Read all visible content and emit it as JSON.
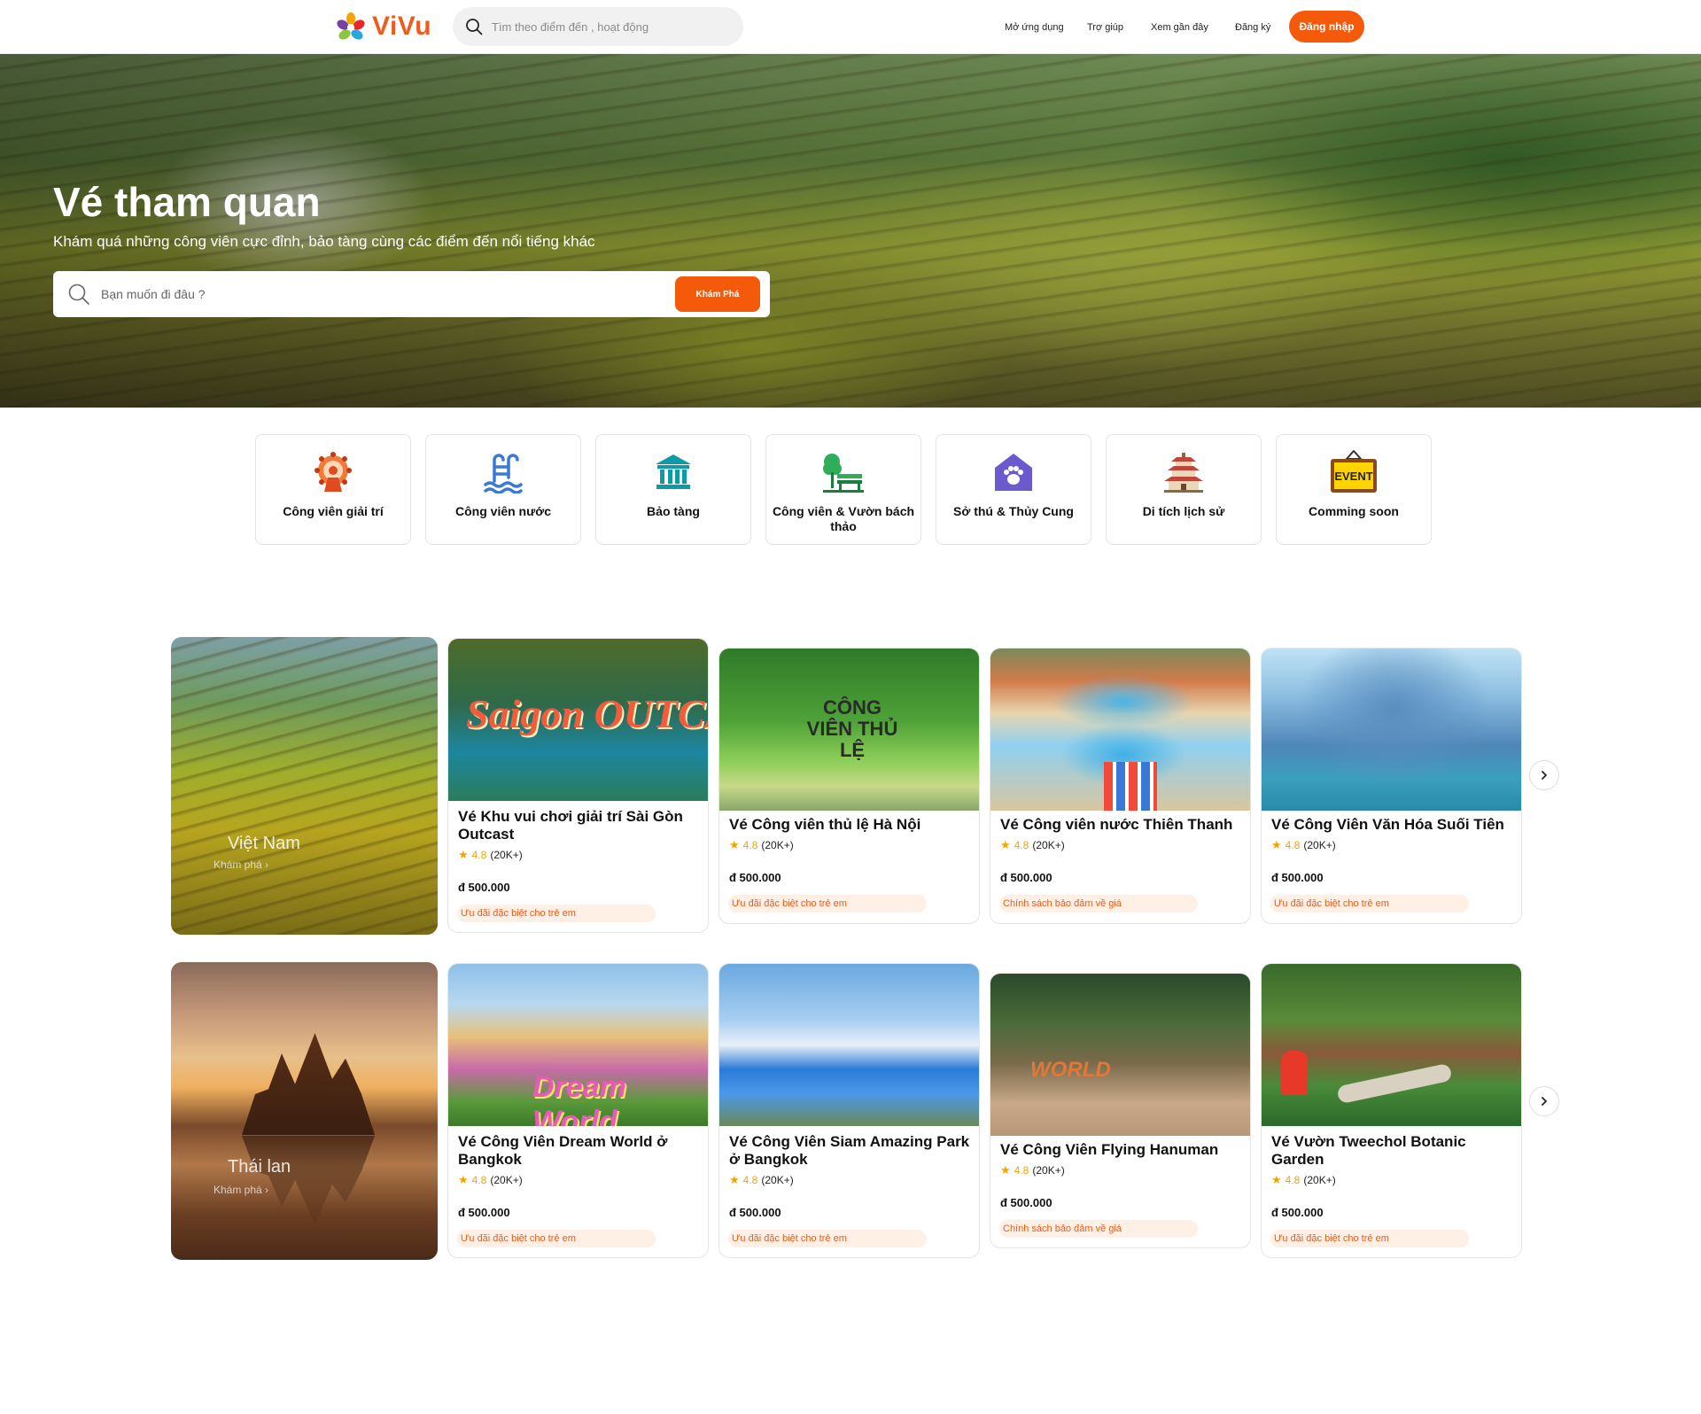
{
  "header": {
    "brand": "ViVu",
    "search_placeholder": "Tìm theo điểm đến , hoạt động",
    "nav": {
      "app": "Mở ứng dụng",
      "help": "Trợ giúp",
      "recent": "Xem gần đây",
      "register": "Đăng ký",
      "login": "Đăng nhập"
    }
  },
  "hero": {
    "title": "Vé tham quan",
    "subtitle": "Khám quá những công viên cực đỉnh, bảo tàng cùng các điểm đến nổi tiếng khác",
    "search_placeholder": "Bạn muốn đi đâu ?",
    "explore_button": "Khám Phá"
  },
  "categories": [
    {
      "label": "Công viên giải trí",
      "icon": "ferris-wheel-icon"
    },
    {
      "label": "Công viên nước",
      "icon": "pool-icon"
    },
    {
      "label": "Bảo tàng",
      "icon": "museum-icon"
    },
    {
      "label": "Công viên & Vườn bách thảo",
      "icon": "park-bench-icon"
    },
    {
      "label": "Sở thú & Thủy Cung",
      "icon": "paw-house-icon"
    },
    {
      "label": "Di tích lịch sử",
      "icon": "pagoda-icon"
    },
    {
      "label": "Comming soon",
      "icon": "event-sign-icon"
    }
  ],
  "sections": [
    {
      "region": {
        "name": "Việt Nam",
        "link": "Khám phá"
      },
      "cards": [
        {
          "title": "Vé Khu vui chơi giải trí Sài Gòn Outcast",
          "rating": "4.8",
          "reviews": "(20K+)",
          "price": "đ 500.000",
          "tag": "Ưu đãi đặc biệt cho trẻ em",
          "image_text": "Saigon OUTCAST"
        },
        {
          "title": "Vé Công viên thủ lệ Hà Nội",
          "rating": "4.8",
          "reviews": "(20K+)",
          "price": "đ 500.000",
          "tag": "Ưu đãi đặc biệt cho trẻ em",
          "image_text": "CÔNG VIÊN THỦ LỆ"
        },
        {
          "title": "Vé Công viên nước Thiên Thanh",
          "rating": "4.8",
          "reviews": "(20K+)",
          "price": "đ 500.000",
          "tag": "Chính sách bảo đảm về giá"
        },
        {
          "title": "Vé Công Viên Văn Hóa Suối Tiên",
          "rating": "4.8",
          "reviews": "(20K+)",
          "price": "đ 500.000",
          "tag": "Ưu đãi đặc biệt cho trẻ em"
        }
      ]
    },
    {
      "region": {
        "name": "Thái lan",
        "link": "Khám phá"
      },
      "cards": [
        {
          "title": "Vé Công Viên Dream World ở Bangkok",
          "rating": "4.8",
          "reviews": "(20K+)",
          "price": "đ 500.000",
          "tag": "Ưu đãi đặc biệt cho trẻ em",
          "image_text": "Dream World"
        },
        {
          "title": "Vé Công Viên Siam Amazing Park ở Bangkok",
          "rating": "4.8",
          "reviews": "(20K+)",
          "price": "đ 500.000",
          "tag": "Ưu đãi đặc biệt cho trẻ em"
        },
        {
          "title": "Vé Công Viên Flying Hanuman",
          "rating": "4.8",
          "reviews": "(20K+)",
          "price": "đ 500.000",
          "tag": "Chính sách bảo đảm về giá",
          "image_text": "WORLD"
        },
        {
          "title": "Vé Vườn Tweechol Botanic Garden",
          "rating": "4.8",
          "reviews": "(20K+)",
          "price": "đ 500.000",
          "tag": "Ưu đãi đặc biệt cho trẻ em"
        }
      ]
    }
  ],
  "colors": {
    "accent": "#f55a0a",
    "tag_bg": "#fff0e5",
    "star": "#f5a300"
  }
}
